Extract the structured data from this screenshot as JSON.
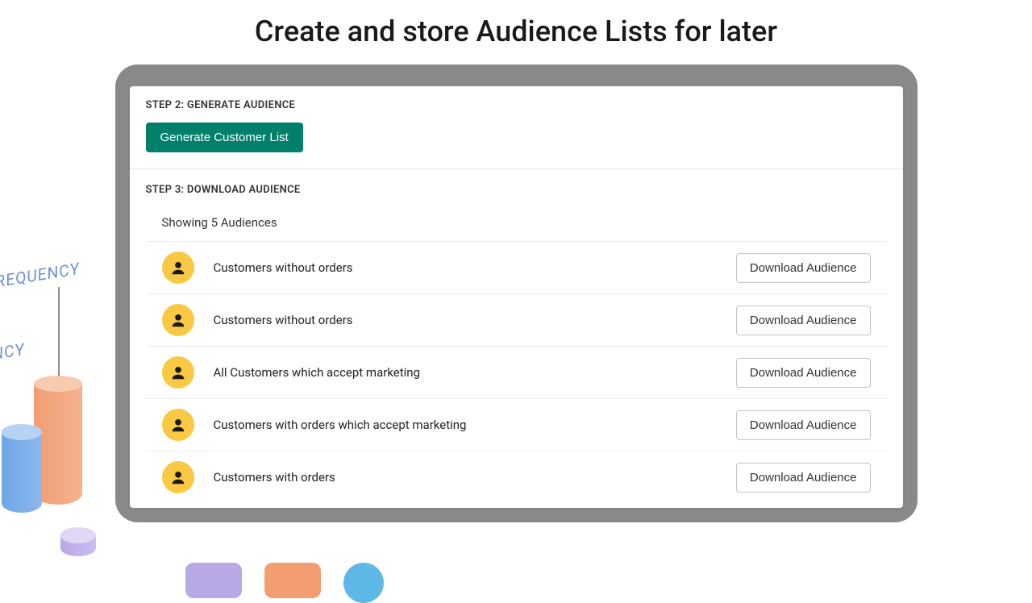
{
  "page_title": "Create and store Audience Lists for later",
  "step2": {
    "label": "STEP 2: GENERATE AUDIENCE",
    "button": "Generate Customer List"
  },
  "step3": {
    "label": "STEP 3: DOWNLOAD AUDIENCE",
    "showing": "Showing 5 Audiences",
    "download_label": "Download Audience",
    "rows": [
      {
        "name": "Customers without orders"
      },
      {
        "name": "Customers without orders"
      },
      {
        "name": "All Customers which accept marketing"
      },
      {
        "name": "Customers with orders which accept marketing"
      },
      {
        "name": "Customers with orders"
      }
    ]
  },
  "bg": {
    "label1": "FREQUENCY",
    "label2": "NCY"
  }
}
